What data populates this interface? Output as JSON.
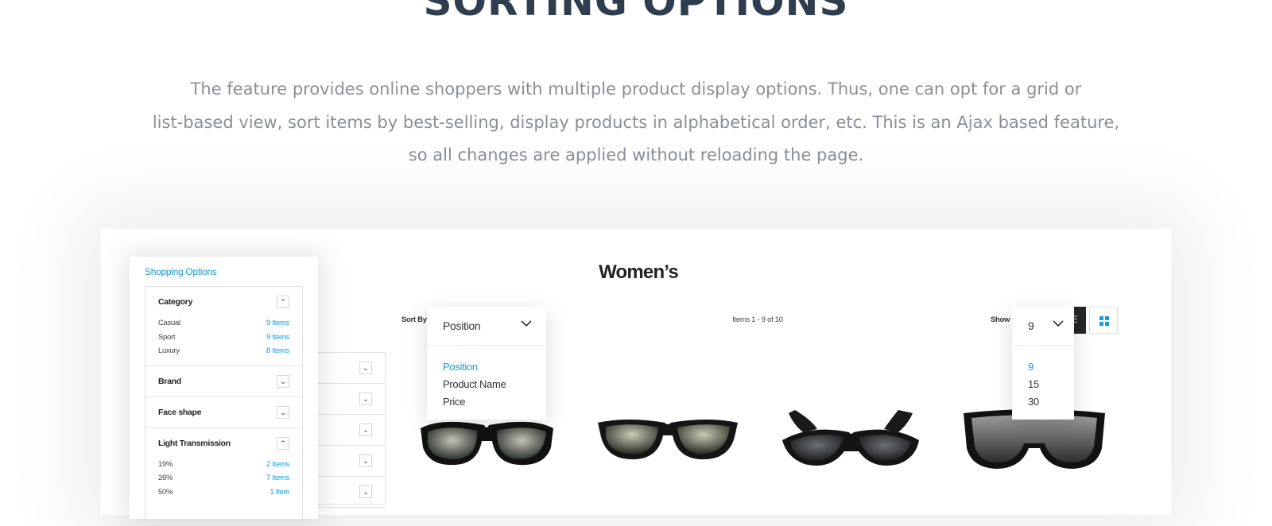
{
  "hero": {
    "title": "SORTING OPTIONS",
    "description_lines": [
      "The feature provides online shoppers with multiple product display options. Thus, one can opt for a grid or",
      "list-based view, sort items by best-selling, display products in alphabetical order, etc. This is an Ajax based feature,",
      "so all changes are applied without reloading the page."
    ]
  },
  "sidebar": {
    "title": "Shopping Options",
    "toggle_expanded_icon": "chevron-up-icon",
    "toggle_collapsed_icon": "chevron-down-icon",
    "filters": [
      {
        "label": "Category",
        "expanded": true,
        "options": [
          {
            "name": "Casual",
            "count": "9 Items"
          },
          {
            "name": "Sport",
            "count": "9 Items"
          },
          {
            "name": "Luxury",
            "count": "8 Items"
          }
        ]
      },
      {
        "label": "Brand",
        "expanded": false
      },
      {
        "label": "Face shape",
        "expanded": false
      },
      {
        "label": "Light Transmission",
        "expanded": true,
        "options": [
          {
            "name": "19%",
            "count": "2 Items"
          },
          {
            "name": "26%",
            "count": "7 Items"
          },
          {
            "name": "50%",
            "count": "1 Item"
          }
        ]
      }
    ]
  },
  "main": {
    "heading": "Women’s",
    "toolbar": {
      "sort_label": "Sort By",
      "sort_selected": "Position",
      "sort_options": [
        "Position",
        "Product Name",
        "Price"
      ],
      "items_count": "Items 1 - 9 of 10",
      "show_label": "Show",
      "show_selected": "9",
      "show_options": [
        "9",
        "15",
        "30"
      ]
    }
  },
  "colors": {
    "accent": "#1a9ad6",
    "heading": "#2f3e4e",
    "body_text": "#8a8f96",
    "dark_button": "#262626"
  }
}
